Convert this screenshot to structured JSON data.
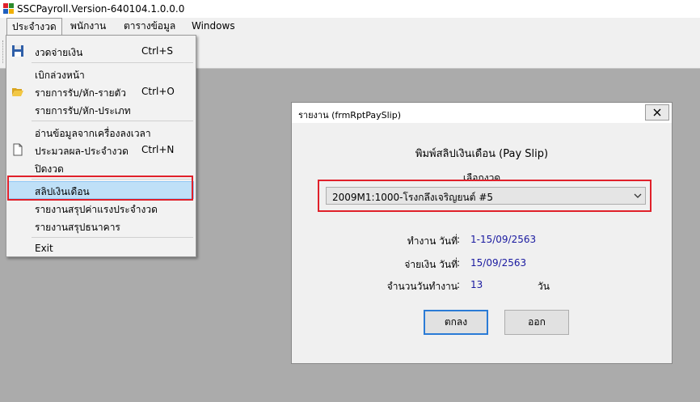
{
  "app": {
    "title": "SSCPayroll.Version-640104.1.0.0.0"
  },
  "menubar": [
    "ประจำงวด",
    "พนักงาน",
    "ตารางข้อมูล",
    "Windows"
  ],
  "dropdown": {
    "items": [
      {
        "label": "งวดจ่ายเงิน",
        "shortcut": "Ctrl+S",
        "icon": "save-icon"
      },
      {
        "label": "เบิกล่วงหน้า",
        "shortcut": "",
        "icon": ""
      },
      {
        "label": "รายการรับ/หัก-รายตัว",
        "shortcut": "Ctrl+O",
        "icon": "folder-open-icon"
      },
      {
        "label": "รายการรับ/หัก-ประเภท",
        "shortcut": "",
        "icon": ""
      },
      {
        "label": "อ่านข้อมูลจากเครื่องลงเวลา",
        "shortcut": "",
        "icon": ""
      },
      {
        "label": "ประมวลผล-ประจำงวด",
        "shortcut": "Ctrl+N",
        "icon": "new-document-icon"
      },
      {
        "label": "ปิดงวด",
        "shortcut": "",
        "icon": ""
      },
      {
        "label": "สลิปเงินเดือน",
        "shortcut": "",
        "icon": "",
        "selected": true
      },
      {
        "label": "รายงานสรุปค่าแรงประจำงวด",
        "shortcut": "",
        "icon": ""
      },
      {
        "label": "รายงานสรุปธนาคาร",
        "shortcut": "",
        "icon": ""
      },
      {
        "label": "Exit",
        "shortcut": "",
        "icon": ""
      }
    ]
  },
  "dialog": {
    "title": "รายงาน (frmRptPaySlip)",
    "heading": "พิมพ์สลิปเงินเดือน (Pay Slip)",
    "select_label": "เลือกงวด",
    "selected_period": "2009M1:1000-โรงกลึงเจริญยนต์ #5",
    "work_label": "ทำงาน วันที่",
    "work_value": "1-15/09/2563",
    "pay_label": "จ่ายเงิน วันที่",
    "pay_value": "15/09/2563",
    "days_label": "จำนวนวันทำงาน",
    "days_value": "13",
    "days_unit": "วัน",
    "colon": ":",
    "ok_label": "ตกลง",
    "exit_label": "ออก"
  },
  "colors": {
    "highlight": "#e0202a",
    "selection": "#bfe0f7",
    "value_text": "#1a1aa0"
  }
}
